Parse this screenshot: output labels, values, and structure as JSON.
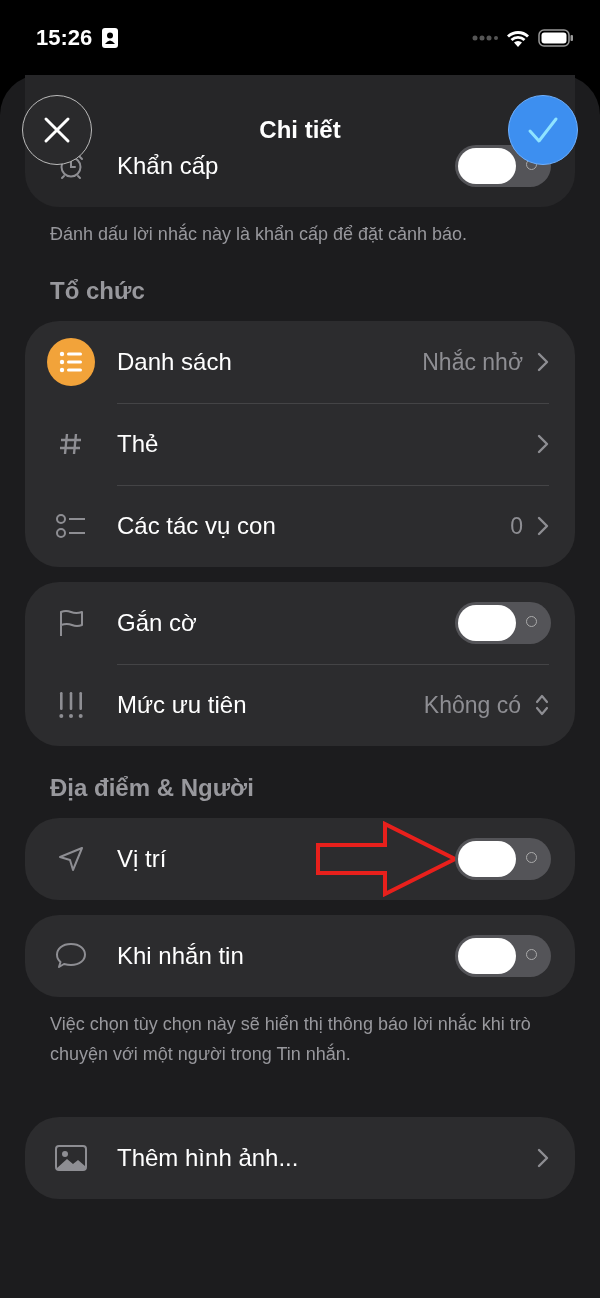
{
  "status_bar": {
    "time": "15:26"
  },
  "header": {
    "title": "Chi tiết"
  },
  "top_card": {
    "rows": [
      {
        "label": "Khẩn cấp",
        "on": false
      }
    ]
  },
  "top_note": "Đánh dấu lời nhắc này là khẩn cấp để đặt cảnh báo.",
  "sections": [
    {
      "title": "Tổ chức",
      "cards": [
        {
          "rows": [
            {
              "kind": "link",
              "label": "Danh sách",
              "value": "Nhắc nhở"
            },
            {
              "kind": "link",
              "label": "Thẻ"
            },
            {
              "kind": "link",
              "label": "Các tác vụ con",
              "value": "0"
            }
          ]
        },
        {
          "rows": [
            {
              "kind": "toggle",
              "label": "Gắn cờ",
              "on": false
            },
            {
              "kind": "picker",
              "label": "Mức ưu tiên",
              "value": "Không có"
            }
          ]
        }
      ]
    },
    {
      "title": "Địa điểm & Người",
      "cards": [
        {
          "rows": [
            {
              "kind": "toggle",
              "label": "Vị trí",
              "on": false,
              "highlighted": true
            }
          ]
        },
        {
          "rows": [
            {
              "kind": "toggle",
              "label": "Khi nhắn tin",
              "on": false
            }
          ]
        }
      ],
      "note": "Việc chọn tùy chọn này sẽ hiển thị thông báo lời nhắc khi trò chuyện với một người trong Tin nhắn."
    },
    {
      "cards": [
        {
          "rows": [
            {
              "kind": "link",
              "label": "Thêm hình ảnh..."
            }
          ]
        }
      ]
    }
  ]
}
